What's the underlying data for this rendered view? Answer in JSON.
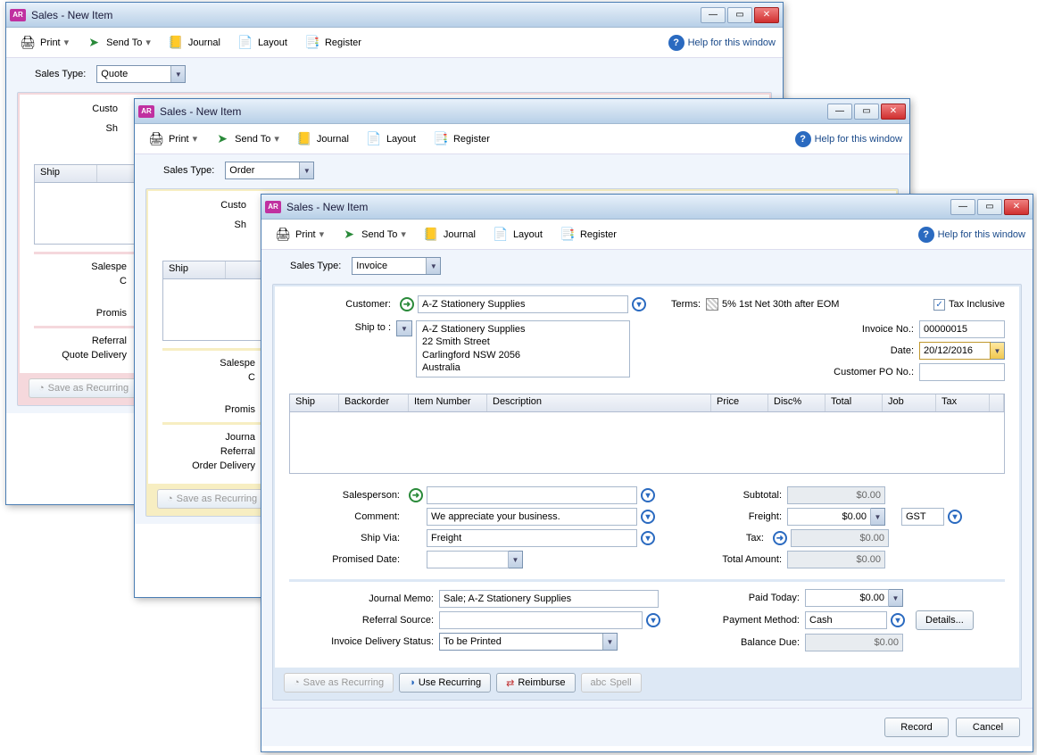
{
  "app_icon_text": "AR",
  "toolbar": {
    "print": "Print",
    "send_to": "Send To",
    "journal": "Journal",
    "layout": "Layout",
    "register": "Register",
    "help": "Help for this window"
  },
  "labels": {
    "sales_type": "Sales Type:",
    "customer": "Customer:",
    "ship_to": "Ship to :",
    "terms": "Terms:",
    "tax_inclusive": "Tax Inclusive",
    "invoice_no": "Invoice No.:",
    "date": "Date:",
    "customer_po": "Customer PO No.:",
    "salesperson": "Salesperson:",
    "comment": "Comment:",
    "ship_via": "Ship Via:",
    "promised_date": "Promised Date:",
    "subtotal": "Subtotal:",
    "freight": "Freight:",
    "tax": "Tax:",
    "total_amount": "Total Amount:",
    "journal_memo": "Journal Memo:",
    "referral_source": "Referral Source:",
    "invoice_delivery": "Invoice Delivery Status:",
    "quote_delivery": "Quote Delivery",
    "order_delivery": "Order Delivery",
    "paid_today": "Paid Today:",
    "payment_method": "Payment Method:",
    "balance_due": "Balance Due:",
    "details_btn": "Details...",
    "save_recurring": "Save as Recurring",
    "use_recurring": "Use Recurring",
    "reimburse": "Reimburse",
    "spell": "Spell",
    "record": "Record",
    "cancel": "Cancel"
  },
  "columns": {
    "ship": "Ship",
    "backorder": "Backorder",
    "item_number": "Item Number",
    "description": "Description",
    "price": "Price",
    "disc": "Disc%",
    "total": "Total",
    "job": "Job",
    "tax": "Tax"
  },
  "windows": [
    {
      "title": "Sales - New Item",
      "sales_type": "Quote"
    },
    {
      "title": "Sales - New Item",
      "sales_type": "Order"
    },
    {
      "title": "Sales - New Item",
      "sales_type": "Invoice"
    }
  ],
  "invoice": {
    "customer": "A-Z Stationery Supplies",
    "ship_to": "A-Z Stationery Supplies\n22 Smith Street\nCarlingford  NSW  2056\nAustralia",
    "terms": "5% 1st Net 30th after EOM",
    "tax_inclusive_checked": true,
    "invoice_no": "00000015",
    "date": "20/12/2016",
    "customer_po": "",
    "salesperson": "",
    "comment": "We appreciate your business.",
    "ship_via": "Freight",
    "promised_date": "",
    "subtotal": "$0.00",
    "freight": "$0.00",
    "freight_tax_code": "GST",
    "tax": "$0.00",
    "total_amount": "$0.00",
    "journal_memo": "Sale; A-Z Stationery Supplies",
    "referral_source": "",
    "delivery_status": "To be Printed",
    "paid_today": "$0.00",
    "payment_method": "Cash",
    "balance_due": "$0.00"
  }
}
